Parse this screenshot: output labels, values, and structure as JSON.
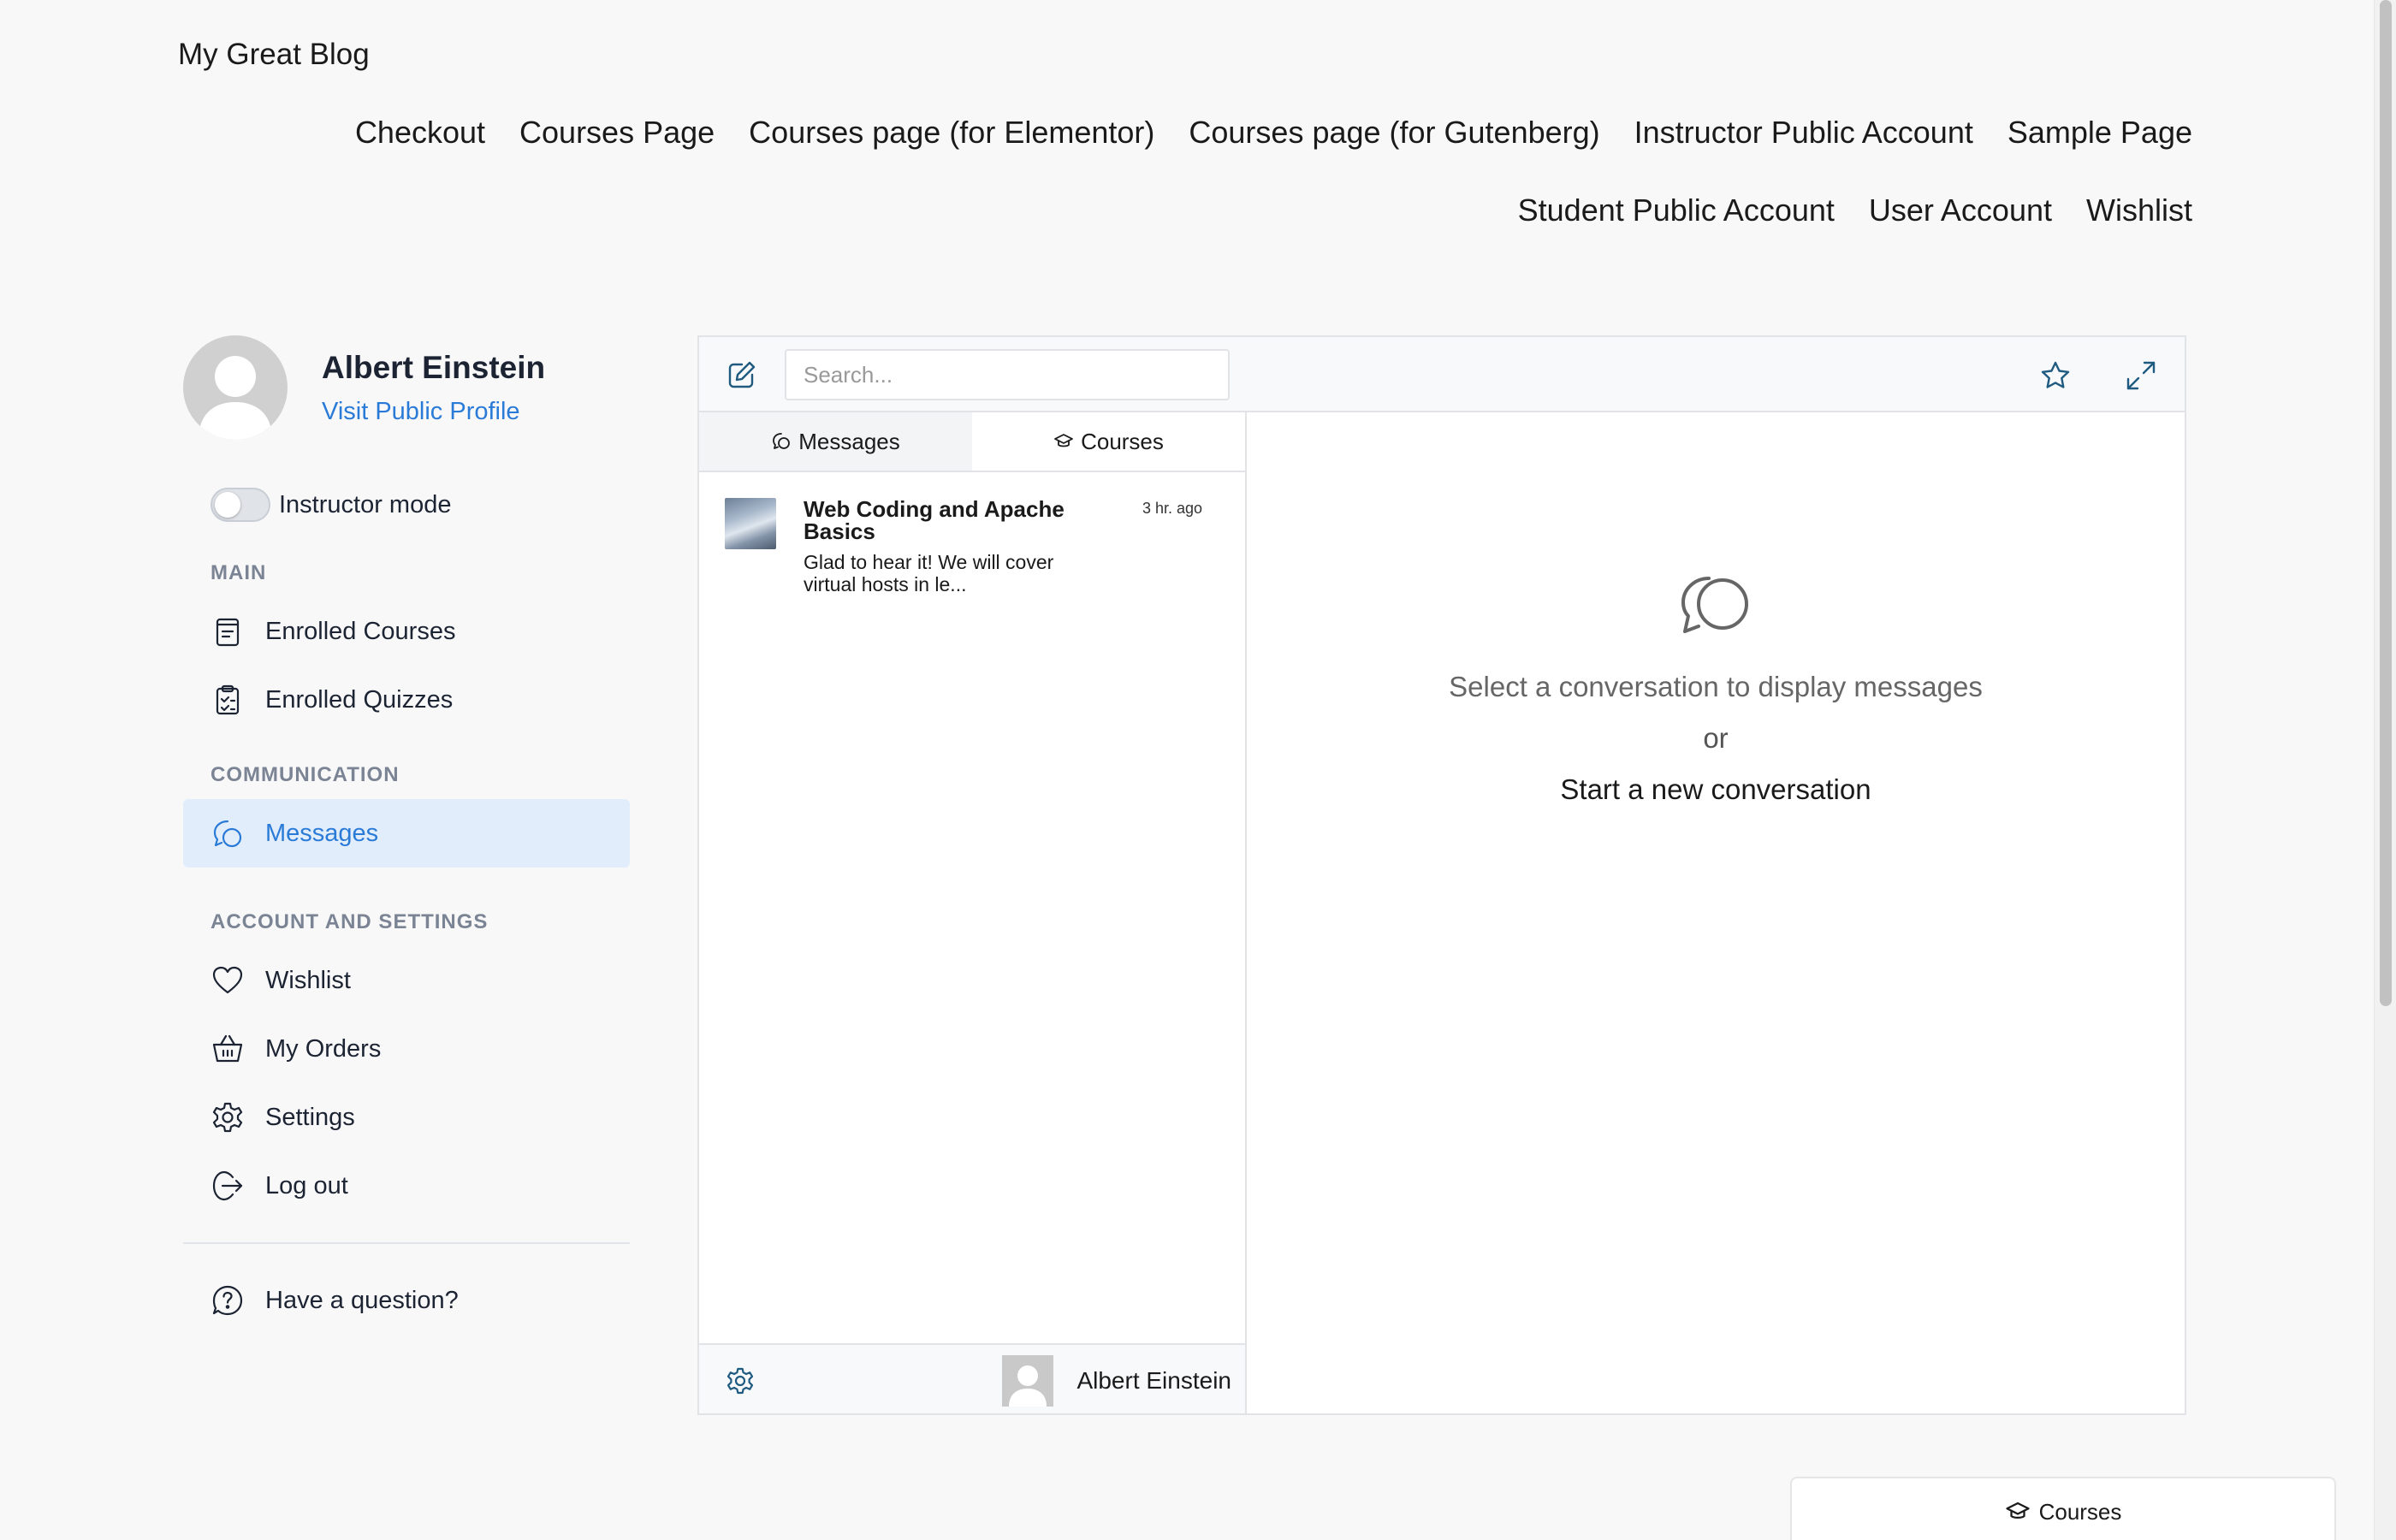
{
  "site": {
    "title": "My Great Blog",
    "nav": [
      "Checkout",
      "Courses Page",
      "Courses page (for Elementor)",
      "Courses page (for Gutenberg)",
      "Instructor Public Account",
      "Sample Page",
      "Student Public Account",
      "User Account",
      "Wishlist"
    ]
  },
  "profile": {
    "name": "Albert Einstein",
    "public_link": "Visit Public Profile",
    "instructor_mode_label": "Instructor mode",
    "instructor_mode_on": false
  },
  "sidebar": {
    "main_label": "MAIN",
    "enrolled_courses": "Enrolled Courses",
    "enrolled_quizzes": "Enrolled Quizzes",
    "communication_label": "COMMUNICATION",
    "messages": "Messages",
    "account_label": "ACCOUNT AND SETTINGS",
    "wishlist": "Wishlist",
    "my_orders": "My Orders",
    "settings": "Settings",
    "log_out": "Log out",
    "have_question": "Have a question?"
  },
  "messenger": {
    "search_placeholder": "Search...",
    "tabs": {
      "messages": "Messages",
      "courses": "Courses"
    },
    "conversations": [
      {
        "title": "Web Coding and Apache Basics",
        "preview": "Glad to hear it! We will cover virtual hosts in le...",
        "time": "3 hr. ago"
      }
    ],
    "footer_user": "Albert Einstein",
    "empty_text": "Select a conversation to display messages",
    "empty_or": "or",
    "empty_start": "Start a new conversation"
  },
  "bottom_tab": {
    "label": "Courses"
  },
  "colors": {
    "accent": "#2a7bd8",
    "icon_teal": "#1f5a80",
    "active_bg": "#e2edfb",
    "page_bg": "#f8f8f8"
  }
}
